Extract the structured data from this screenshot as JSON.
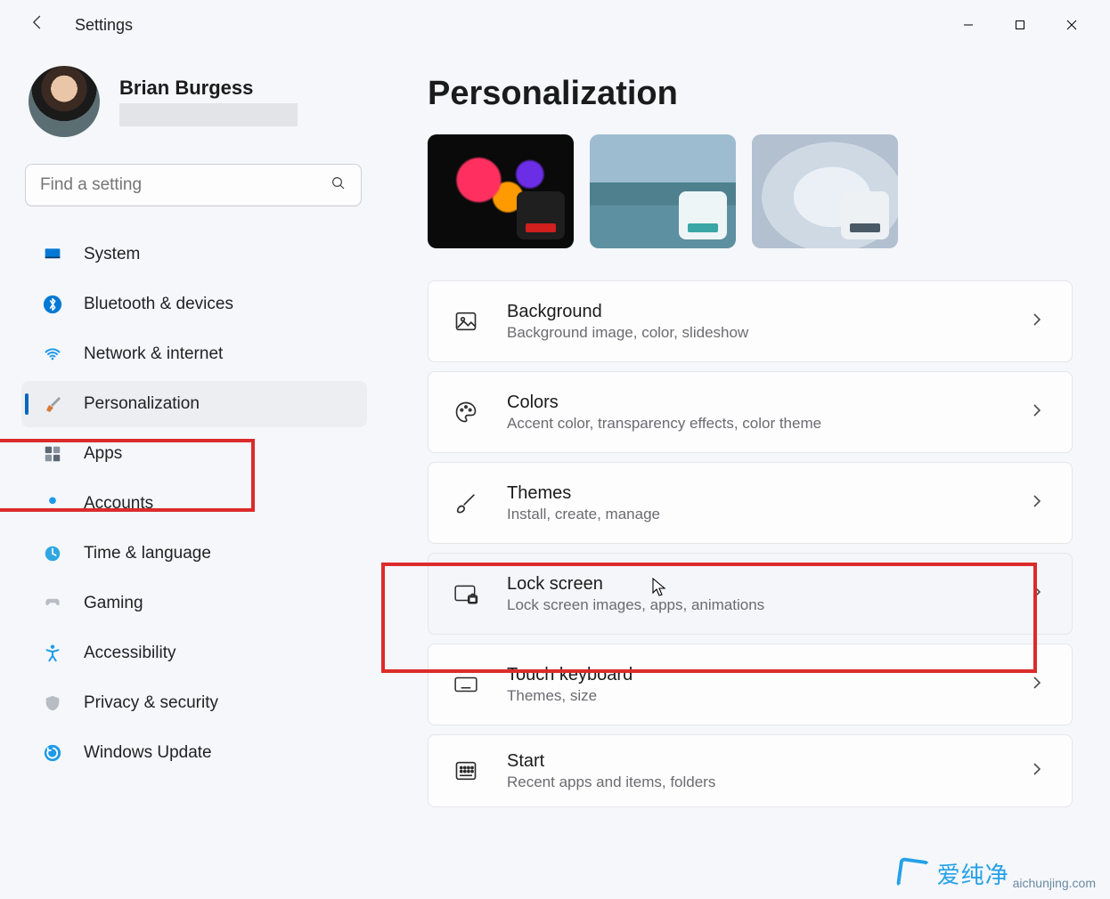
{
  "window": {
    "app_title": "Settings"
  },
  "user": {
    "display_name": "Brian Burgess"
  },
  "search": {
    "placeholder": "Find a setting"
  },
  "sidebar": {
    "items": [
      {
        "label": "System"
      },
      {
        "label": "Bluetooth & devices"
      },
      {
        "label": "Network & internet"
      },
      {
        "label": "Personalization"
      },
      {
        "label": "Apps"
      },
      {
        "label": "Accounts"
      },
      {
        "label": "Time & language"
      },
      {
        "label": "Gaming"
      },
      {
        "label": "Accessibility"
      },
      {
        "label": "Privacy & security"
      },
      {
        "label": "Windows Update"
      }
    ],
    "selected_index": 3
  },
  "page": {
    "title": "Personalization"
  },
  "cards": [
    {
      "title": "Background",
      "subtitle": "Background image, color, slideshow"
    },
    {
      "title": "Colors",
      "subtitle": "Accent color, transparency effects, color theme"
    },
    {
      "title": "Themes",
      "subtitle": "Install, create, manage"
    },
    {
      "title": "Lock screen",
      "subtitle": "Lock screen images, apps, animations"
    },
    {
      "title": "Touch keyboard",
      "subtitle": "Themes, size"
    },
    {
      "title": "Start",
      "subtitle": "Recent apps and items, folders"
    }
  ],
  "hovered_card_index": 3,
  "annotations": {
    "highlight_sidebar_index": 3,
    "highlight_card_index": 3
  },
  "watermark": {
    "text": "爱纯净",
    "url": "aichunjing.com"
  }
}
